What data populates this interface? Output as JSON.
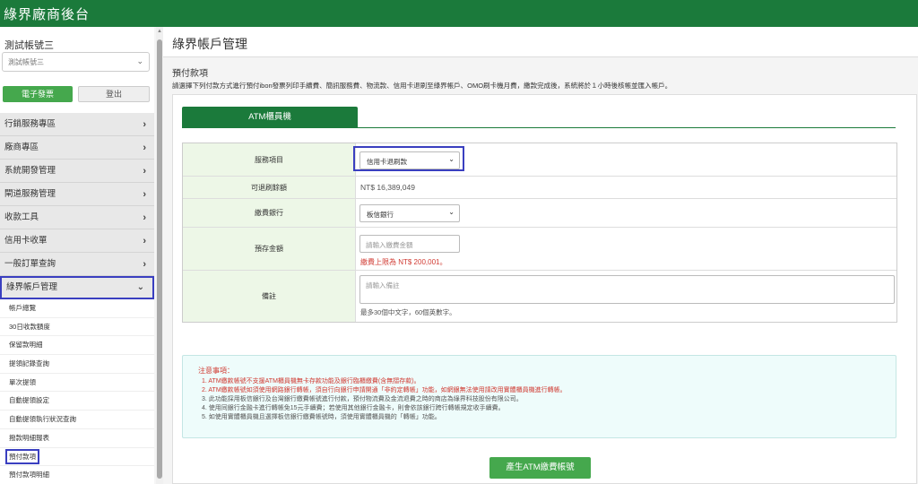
{
  "app": {
    "brand": "綠界廠商後台"
  },
  "sidebar": {
    "account_name": "測試帳號三",
    "account_select": "測試帳號三",
    "epaper_button": "電子發票",
    "logout_button": "登出",
    "menu": [
      {
        "label": "行銷服務專區"
      },
      {
        "label": "廠商專區"
      },
      {
        "label": "系統開發管理"
      },
      {
        "label": "閘道服務管理"
      },
      {
        "label": "收款工具"
      },
      {
        "label": "信用卡收單"
      },
      {
        "label": "一般訂單查詢"
      },
      {
        "label": "綠界帳戶管理"
      }
    ],
    "submenu": [
      {
        "label": "帳戶總覽"
      },
      {
        "label": "30日收款額度"
      },
      {
        "label": "保留款明細"
      },
      {
        "label": "提領記錄查詢"
      },
      {
        "label": "單次提領"
      },
      {
        "label": "自動提領設定"
      },
      {
        "label": "自動提領執行狀況查詢"
      },
      {
        "label": "撥款明細報表"
      },
      {
        "label": "預付款項"
      },
      {
        "label": "預付款項明細"
      }
    ]
  },
  "main": {
    "page_title": "綠界帳戶管理",
    "section_title": "預付款項",
    "notice": "請選擇下列付款方式進行預付ibon發票列印手續費、簡訊服務費、物流款、信用卡退刷至綠界帳戶、OMO刷卡機月費，繳款完成後，系統將於１小時後核帳並匯入帳戶。",
    "tab_label": "ATM櫃員機",
    "form": {
      "service_label": "服務項目",
      "service_value": "信用卡退刷款",
      "refundable_label": "可退刷餘額",
      "refundable_value": "NT$ 16,389,049",
      "bank_label": "繳費銀行",
      "bank_value": "板信銀行",
      "amount_label": "預存金額",
      "amount_placeholder": "請輸入繳費金額",
      "amount_limit": "繳費上限為 NT$ 200,001。",
      "remark_label": "備註",
      "remark_placeholder": "請輸入備註",
      "remark_help": "最多30個中文字，60個英數字。"
    },
    "notes": {
      "title": "注意事項：",
      "items": [
        "1. ATM繳款帳號不支援ATM櫃員機無卡存款功能及銀行臨櫃繳費(含無摺存款)。",
        "2. ATM繳款帳號如須使用網路銀行轉帳，須自行向銀行申請開通「非約定轉帳」功能，如網銀無法使用請改用實體櫃員機進行轉帳。",
        "3. 此功能採用板信銀行及台灣銀行繳費帳號進行付款，預付物流費及金流退費之時的商店為綠界科技股份有限公司。",
        "4. 使用同銀行金融卡進行轉帳免15元手續費；若使用其他銀行金融卡，則會依該銀行跨行轉帳規定收手續費。",
        "5. 如使用實體櫃員機且選擇板信銀行繳費帳號時，須使用實體櫃員機的「轉帳」功能。"
      ]
    },
    "submit_button": "產生ATM繳費帳號"
  }
}
